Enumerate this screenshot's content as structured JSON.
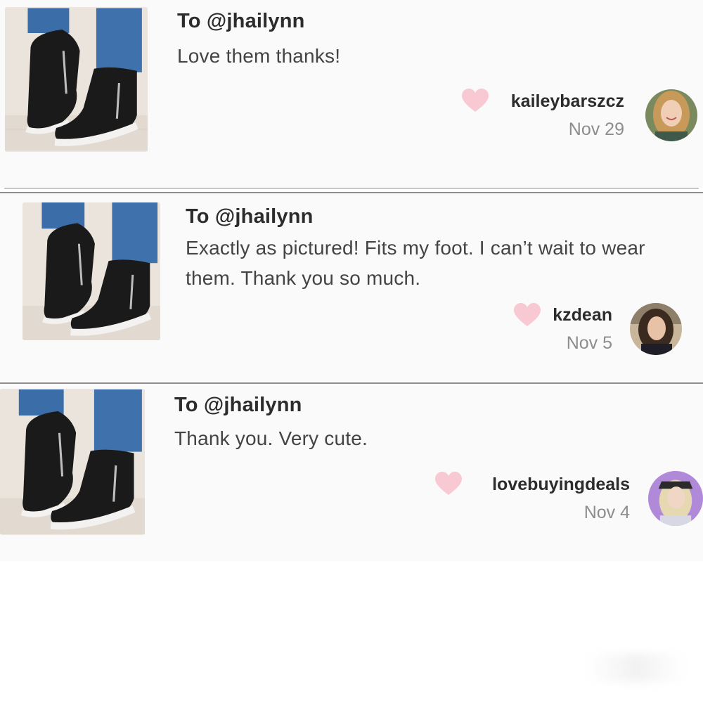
{
  "reviews": [
    {
      "to": "To @jhailynn",
      "message": "Love them thanks!",
      "username": "kaileybarszcz",
      "date": "Nov 29",
      "avatar_hair": "#c89a5a",
      "avatar_bg": "#7a8a5e"
    },
    {
      "to": "To @jhailynn",
      "message": "Exactly as pictured! Fits my foot. I can’t wait to wear them. Thank you so much.",
      "username": "kzdean",
      "date": "Nov 5",
      "avatar_hair": "#3b2a20",
      "avatar_bg": "#c8b59a"
    },
    {
      "to": "To @jhailynn",
      "message": "Thank you. Very cute.",
      "username": "lovebuyingdeals",
      "date": "Nov 4",
      "avatar_hair": "#e6d8b0",
      "avatar_bg": "#b08ad8"
    }
  ],
  "colors": {
    "heart": "#f8c9d2",
    "shoe": "#1b1a1b",
    "sole": "#f4f2f0",
    "jeans": "#3b6ea8"
  },
  "icons": {
    "like": "heart-icon"
  }
}
